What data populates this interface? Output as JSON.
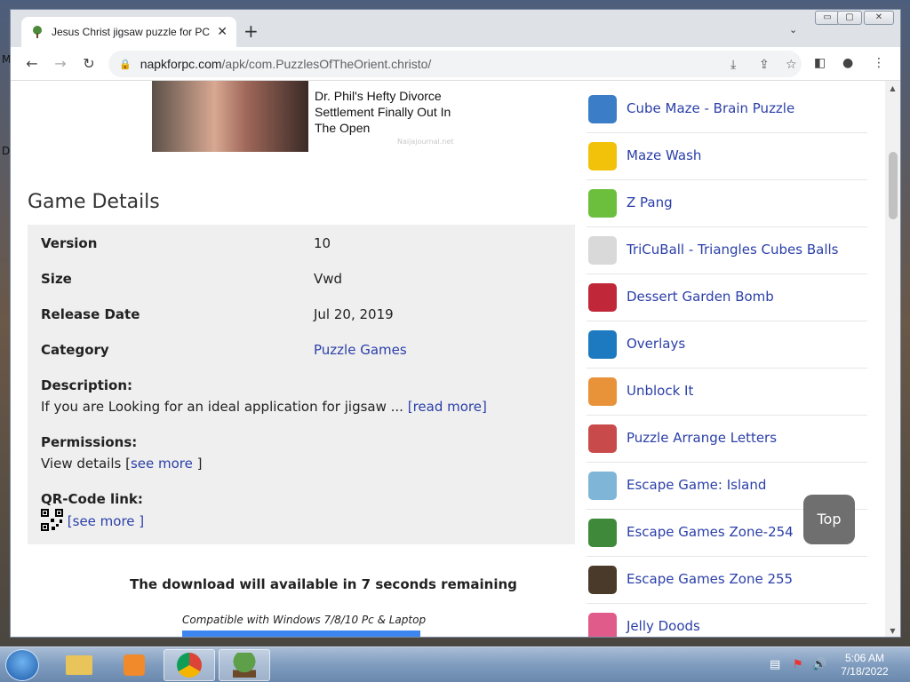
{
  "browser": {
    "tab_title": "Jesus Christ jigsaw puzzle for PC",
    "tab_close": "✕",
    "new_tab": "+",
    "tab_menu": "⌄",
    "window_controls": [
      "▭",
      "▢",
      "✕"
    ],
    "url_host": "napkforpc.com",
    "url_path": "/apk/com.PuzzlesOfTheOrient.christo/"
  },
  "desktop": {
    "left_chars": [
      "M",
      "D"
    ]
  },
  "ad": {
    "headline": "Dr. Phil's Hefty Divorce Settlement Finally Out In The Open",
    "source": "Naijajournal.net"
  },
  "game_details": {
    "title": "Game Details",
    "rows": [
      {
        "key": "Version",
        "value": "10"
      },
      {
        "key": "Size",
        "value": "Vwd"
      },
      {
        "key": "Release Date",
        "value": "Jul 20, 2019"
      },
      {
        "key": "Category",
        "value": "Puzzle Games"
      }
    ],
    "description_label": "Description:",
    "description_text": "If you are Looking for an ideal application for jigsaw ...",
    "read_more": "[read more]",
    "permissions_label": "Permissions:",
    "permissions_text": "View details [",
    "permissions_link": "see more",
    "permissions_close": " ]",
    "qr_label": "QR-Code link:",
    "qr_link": "[see more ]"
  },
  "download": {
    "countdown": "The download will available in 7 seconds remaining",
    "compat": "Compatible with Windows 7/8/10 Pc & Laptop"
  },
  "related_games": [
    {
      "name": "Cube Maze - Brain Puzzle",
      "icon": "cube-maze-icon",
      "color": "#3b7dc6"
    },
    {
      "name": "Maze Wash",
      "icon": "maze-wash-icon",
      "color": "#f2c20a"
    },
    {
      "name": "Z Pang",
      "icon": "z-pang-icon",
      "color": "#6bbf3c"
    },
    {
      "name": "TriCuBall - Triangles Cubes Balls",
      "icon": "tricuball-icon",
      "color": "#d9d9d9"
    },
    {
      "name": "Dessert Garden Bomb",
      "icon": "dessert-garden-bomb-icon",
      "color": "#c0283a"
    },
    {
      "name": "Overlays",
      "icon": "overlays-icon",
      "color": "#1e7ac0"
    },
    {
      "name": "Unblock It",
      "icon": "unblock-it-icon",
      "color": "#e8923a"
    },
    {
      "name": "Puzzle Arrange Letters",
      "icon": "puzzle-arrange-letters-icon",
      "color": "#c94a4a"
    },
    {
      "name": "Escape Game: Island",
      "icon": "escape-game-island-icon",
      "color": "#7fb6d8"
    },
    {
      "name": "Escape Games Zone-254",
      "icon": "escape-games-zone-254-icon",
      "color": "#3e8a3a"
    },
    {
      "name": "Escape Games Zone 255",
      "icon": "escape-games-zone-255-icon",
      "color": "#4a3a2a"
    },
    {
      "name": "Jelly Doods",
      "icon": "jelly-doods-icon",
      "color": "#e05a8a"
    }
  ],
  "top_button": "Top",
  "taskbar": {
    "time": "5:06 AM",
    "date": "7/18/2022"
  }
}
